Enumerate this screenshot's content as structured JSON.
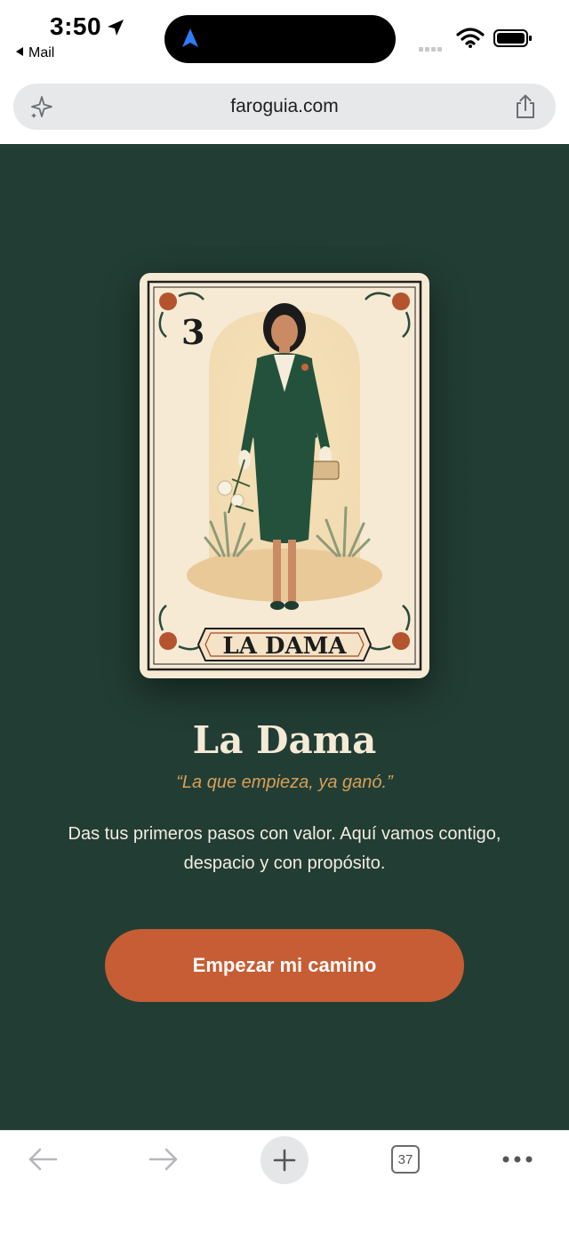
{
  "status_bar": {
    "time": "3:50",
    "back_app": "Mail",
    "icons": [
      "location-arrow-icon",
      "maps-navigation-icon",
      "cellular-signal-icon",
      "wifi-icon",
      "battery-icon"
    ]
  },
  "browser": {
    "url": "faroguia.com",
    "left_icon": "sparkle-icon",
    "right_icon": "share-icon"
  },
  "card": {
    "number": "3",
    "banner": "LA DAMA"
  },
  "content": {
    "title": "La Dama",
    "tagline": "“La que empieza, ya ganó.”",
    "description": "Das tus primeros pasos con valor. Aquí vamos contigo, despacio y con propósito.",
    "cta_label": "Empezar mi camino"
  },
  "toolbar": {
    "tabs_count": "37",
    "icons": [
      "back-arrow-icon",
      "forward-arrow-icon",
      "plus-icon",
      "tabs-icon",
      "more-icon"
    ]
  },
  "colors": {
    "background": "#223d34",
    "accent": "#c65d34",
    "tagline": "#d7a058",
    "card": "#f6ead4"
  }
}
